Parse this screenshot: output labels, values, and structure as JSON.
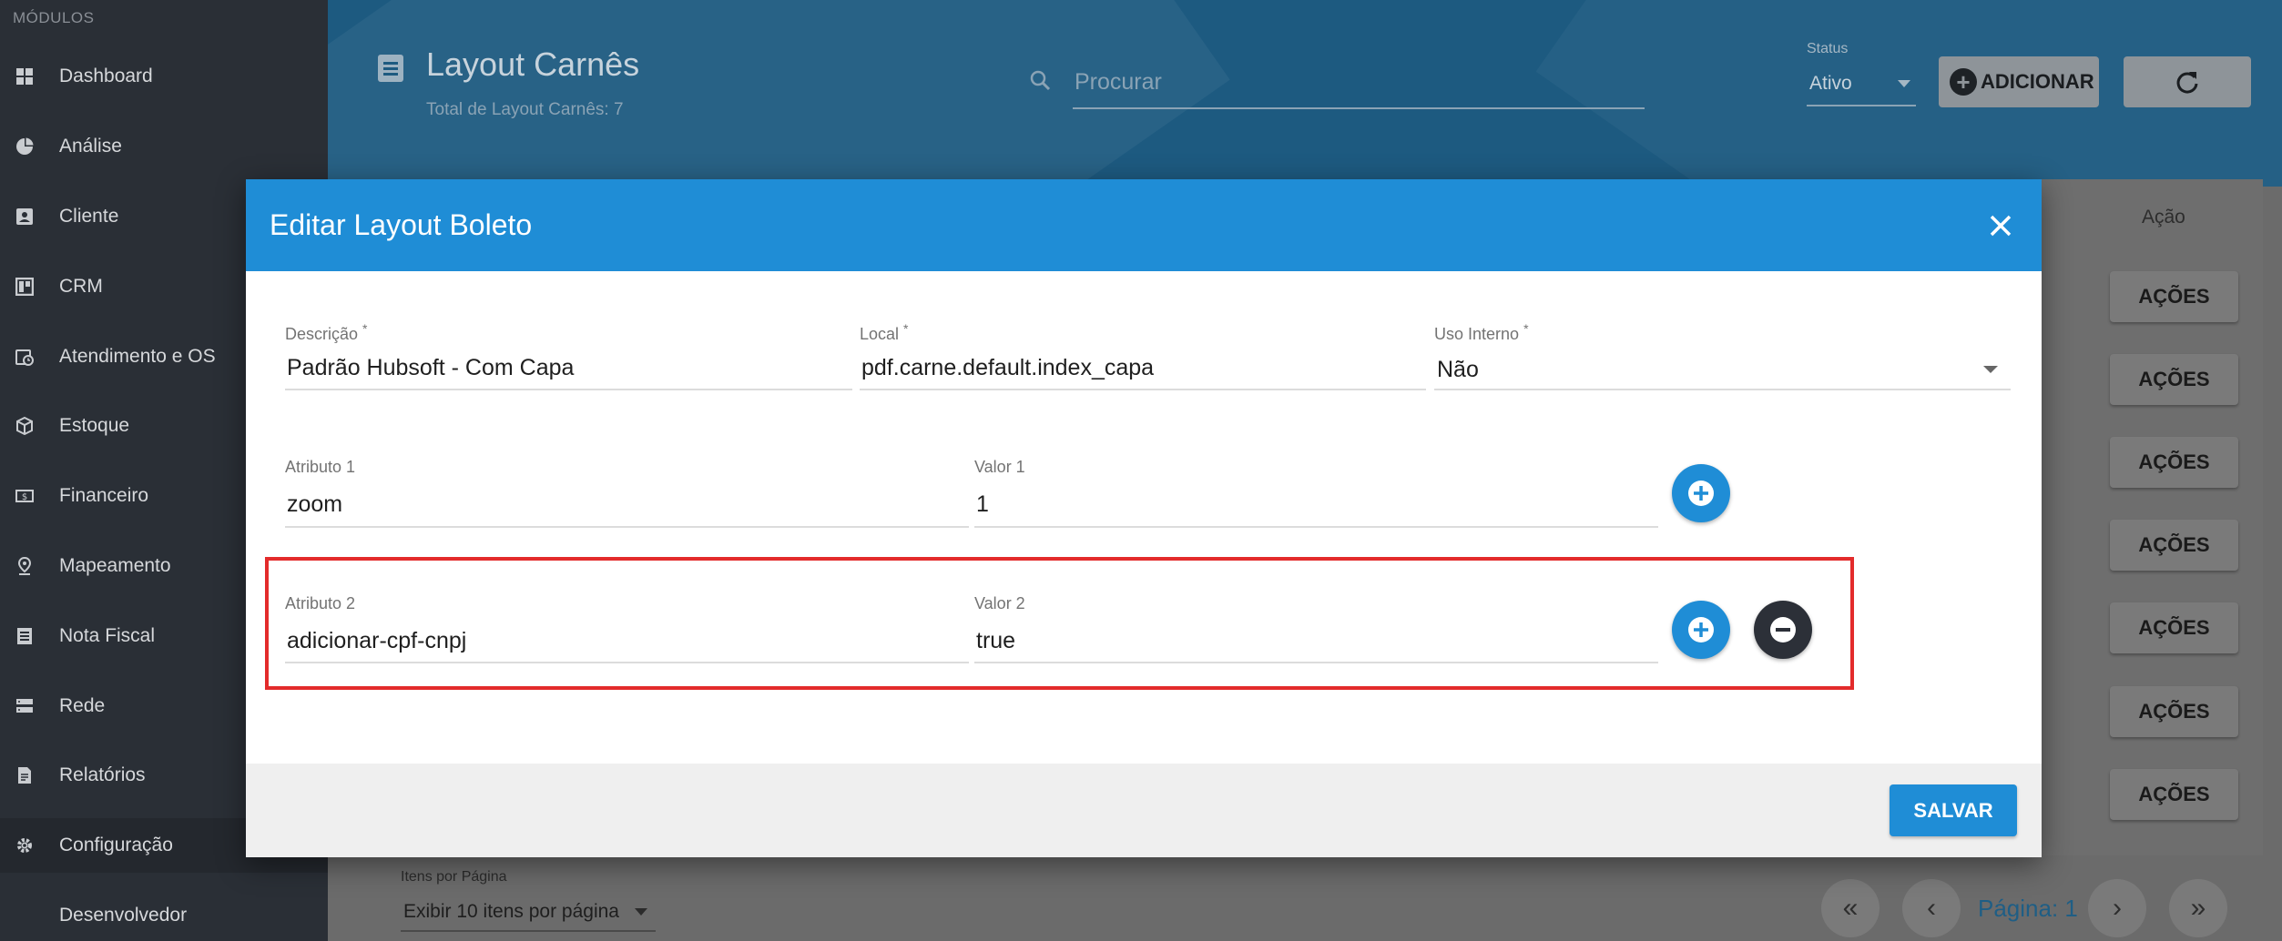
{
  "sidebar": {
    "section": "MÓDULOS",
    "items": [
      {
        "label": "Dashboard",
        "icon": "dashboard-icon"
      },
      {
        "label": "Análise",
        "icon": "pie-chart-icon"
      },
      {
        "label": "Cliente",
        "icon": "contact-card-icon"
      },
      {
        "label": "CRM",
        "icon": "board-icon"
      },
      {
        "label": "Atendimento e OS",
        "icon": "calendar-clock-icon"
      },
      {
        "label": "Estoque",
        "icon": "box-icon"
      },
      {
        "label": "Financeiro",
        "icon": "money-icon"
      },
      {
        "label": "Mapeamento",
        "icon": "map-pin-icon"
      },
      {
        "label": "Nota Fiscal",
        "icon": "receipt-icon"
      },
      {
        "label": "Rede",
        "icon": "server-icon"
      },
      {
        "label": "Relatórios",
        "icon": "document-icon"
      },
      {
        "label": "Configuração",
        "icon": "gear-icon"
      },
      {
        "label": "Desenvolvedor",
        "icon": ""
      }
    ]
  },
  "header": {
    "title": "Layout Carnês",
    "subtitle": "Total de Layout Carnês: 7",
    "search_placeholder": "Procurar",
    "status_label": "Status",
    "status_value": "Ativo",
    "add_label": "ADICIONAR"
  },
  "table": {
    "action_header": "Ação",
    "action_label": "AÇÕES",
    "rows": 7,
    "items_per_page_label": "Itens por Página",
    "items_per_page_value": "Exibir 10 itens por página",
    "page_label": "Página: 1"
  },
  "modal": {
    "title": "Editar Layout Boleto",
    "descricao_label": "Descrição",
    "descricao_value": "Padrão Hubsoft - Com Capa",
    "local_label": "Local",
    "local_value": "pdf.carne.default.index_capa",
    "uso_label": "Uso Interno",
    "uso_value": "Não",
    "required_mark": "*",
    "attributes": [
      {
        "attr_label": "Atributo 1",
        "attr_value": "zoom",
        "val_label": "Valor 1",
        "val_value": "1"
      },
      {
        "attr_label": "Atributo 2",
        "attr_value": "adicionar-cpf-cnpj",
        "val_label": "Valor 2",
        "val_value": "true"
      }
    ],
    "save_label": "SALVAR"
  },
  "colors": {
    "primary": "#1f8dd6",
    "sidebar": "#2a2f36",
    "highlight": "#e32b2b"
  }
}
